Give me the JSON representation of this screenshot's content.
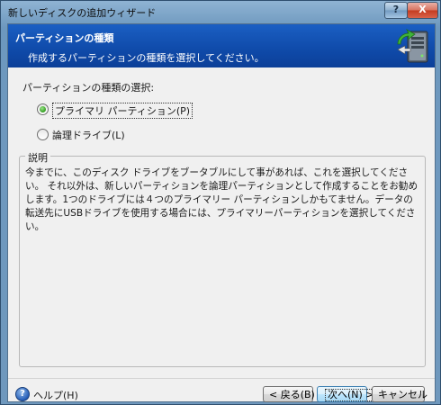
{
  "window": {
    "title": "新しいディスクの追加ウィザード",
    "help_button": "?",
    "close_button": "X"
  },
  "header": {
    "title": "パーティションの種類",
    "subtitle": "作成するパーティションの種類を選択してください。",
    "icon": "disk-wizard-icon"
  },
  "content": {
    "prompt": "パーティションの種類の選択:",
    "options": [
      {
        "label": "プライマリ パーティション(P)",
        "selected": true
      },
      {
        "label": "論理ドライブ(L)",
        "selected": false
      }
    ],
    "group_title": "説明",
    "description": "今までに、このディスク ドライブをブータブルにして事があれば、これを選択してください。 それ以外は、新しいパーティションを論理パーティションとして作成することをお勧めします。1つのドライブには４つのプライマリー パーティションしかもてません。データの転送先にUSBドライブを使用する場合には、プライマリーパーティションを選択してください。"
  },
  "footer": {
    "help_label": "ヘルプ(H)",
    "back_label": "< 戻る(B)",
    "next_label": "次へ(N) >",
    "cancel_label": "キャンセル"
  },
  "colors": {
    "header_bg": "#0f4aa9",
    "radio_selected": "#2f9c1e",
    "default_button": "#bee6fd"
  }
}
